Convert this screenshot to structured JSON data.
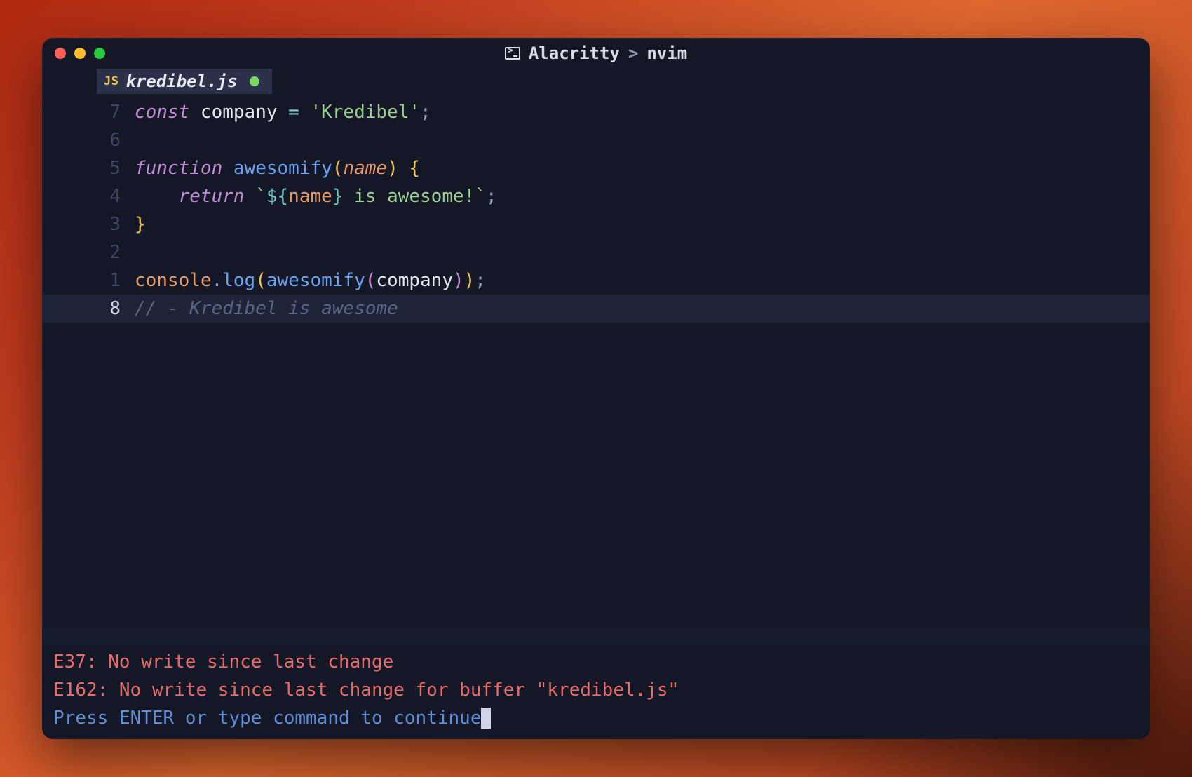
{
  "window": {
    "app": "Alacritty",
    "separator": ">",
    "process": "nvim"
  },
  "tab": {
    "badge": "JS",
    "filename": "kredibel.js",
    "modified": true
  },
  "gutter": [
    "7",
    "6",
    "5",
    "4",
    "3",
    "2",
    "1",
    "8"
  ],
  "code": {
    "l0": {
      "kw": "const ",
      "ident": "company ",
      "op": "= ",
      "str": "'Kredibel'",
      "semi": ";"
    },
    "l1": "",
    "l2": {
      "kw": "function ",
      "fn": "awesomify",
      "po": "(",
      "param": "name",
      "pc": ") ",
      "brace": "{"
    },
    "l3": {
      "indent": "    ",
      "kw": "return ",
      "tick1": "`",
      "interp_open": "${",
      "interp_var": "name",
      "interp_close": "}",
      "rest": " is awesome!",
      "tick2": "`",
      "semi": ";"
    },
    "l4": {
      "brace": "}"
    },
    "l5": "",
    "l6": {
      "obj": "console",
      "dot": ".",
      "fn": "log",
      "po": "(",
      "call": "awesomify",
      "po2": "(",
      "arg": "company",
      "pc2": ")",
      "pc": ")",
      "semi": ";"
    },
    "l7": {
      "comment": "// - Kredibel is awesome"
    }
  },
  "messages": {
    "err1": "E37: No write since last change",
    "err2": "E162: No write since last change for buffer \"kredibel.js\"",
    "prompt": "Press ENTER or type command to continue"
  }
}
